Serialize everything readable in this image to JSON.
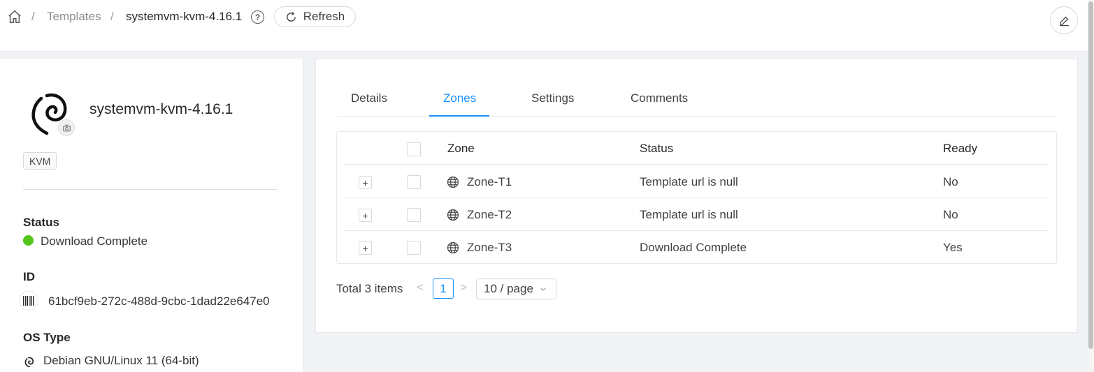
{
  "breadcrumb": {
    "separator": "/",
    "templates": "Templates",
    "current": "systemvm-kvm-4.16.1"
  },
  "toolbar": {
    "help_glyph": "?",
    "refresh_label": "Refresh"
  },
  "resource": {
    "name": "systemvm-kvm-4.16.1",
    "tag": "KVM"
  },
  "fields": {
    "status_label": "Status",
    "status_value": "Download Complete",
    "status_color": "#52c41a",
    "id_label": "ID",
    "id_value": "61bcf9eb-272c-488d-9cbc-1dad22e647e0",
    "ostype_label": "OS Type",
    "ostype_value": "Debian GNU/Linux 11 (64-bit)"
  },
  "tabs": [
    {
      "label": "Details"
    },
    {
      "label": "Zones"
    },
    {
      "label": "Settings"
    },
    {
      "label": "Comments"
    }
  ],
  "active_tab": "Zones",
  "table": {
    "headers": {
      "zone": "Zone",
      "status": "Status",
      "ready": "Ready"
    },
    "expand_glyph": "+",
    "rows": [
      {
        "zone": "Zone-T1",
        "status": "Template url is null",
        "ready": "No"
      },
      {
        "zone": "Zone-T2",
        "status": "Template url is null",
        "ready": "No"
      },
      {
        "zone": "Zone-T3",
        "status": "Download Complete",
        "ready": "Yes"
      }
    ]
  },
  "pagination": {
    "total": "Total 3 items",
    "prev": "<",
    "current_page": "1",
    "next": ">",
    "page_size": "10 / page"
  },
  "colors": {
    "accent": "#1890ff",
    "success": "#52c41a"
  }
}
